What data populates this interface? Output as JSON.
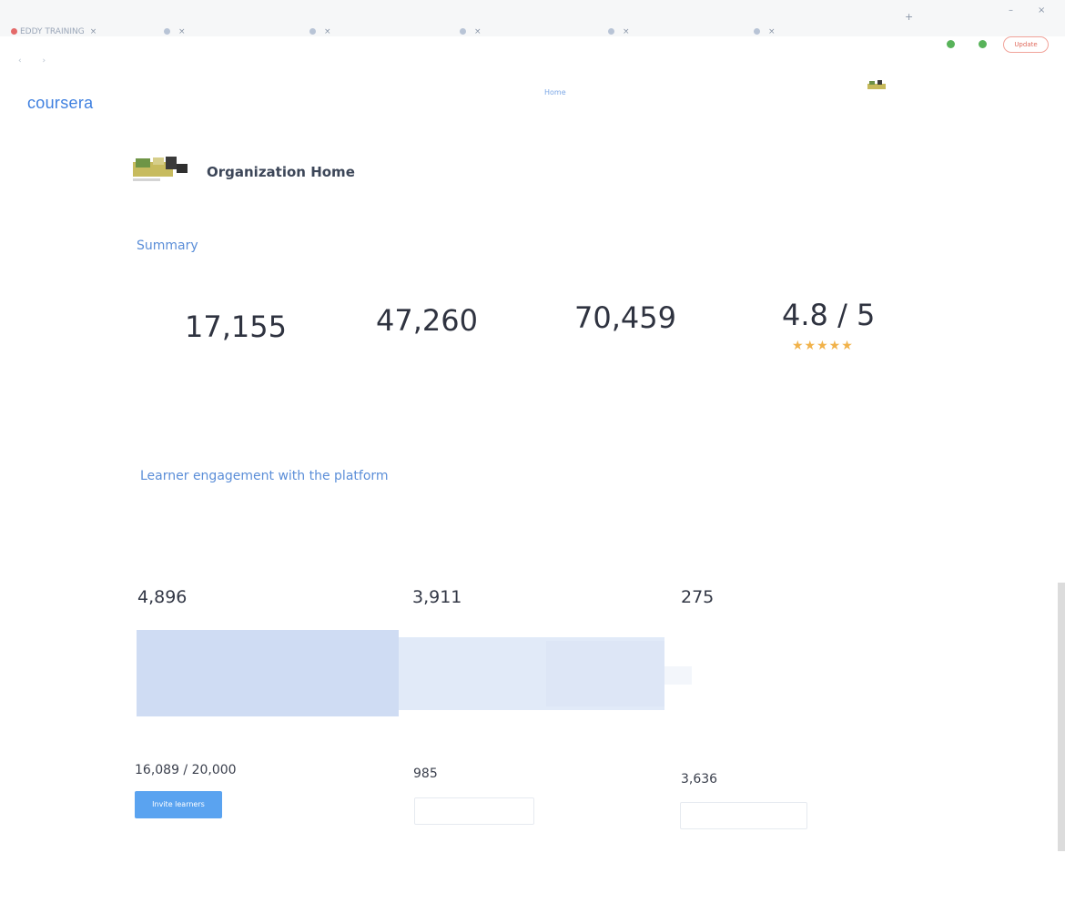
{
  "browser": {
    "tabs": [
      {
        "label": "EDDY TRAINING",
        "favicon": "red"
      },
      {
        "label": "",
        "favicon": "blue"
      },
      {
        "label": "",
        "favicon": "blue"
      },
      {
        "label": "",
        "favicon": "blue"
      },
      {
        "label": "",
        "favicon": "blue"
      },
      {
        "label": "",
        "favicon": "blue"
      }
    ],
    "profile_button": "Update"
  },
  "header": {
    "logo": "coursera",
    "nav_home": "Home"
  },
  "org": {
    "title": "Organization Home"
  },
  "summary": {
    "title": "Summary",
    "metrics": [
      {
        "value": "17,155"
      },
      {
        "value": "47,260"
      },
      {
        "value": "70,459"
      },
      {
        "value": "4.8 / 5"
      }
    ],
    "rating_stars": 5
  },
  "engagement": {
    "title": "Learner engagement with the platform",
    "columns": [
      {
        "value": "4,896"
      },
      {
        "value": "3,911"
      },
      {
        "value": "275"
      }
    ],
    "bottom": [
      {
        "value": "16,089 / 20,000",
        "button": "Invite learners"
      },
      {
        "value": "985"
      },
      {
        "value": "3,636"
      }
    ]
  },
  "colors": {
    "brand": "#3f80e0",
    "section_title": "#5b8ed8",
    "star": "#f1b24a",
    "primary_button": "#5aa3f0",
    "funnel_1": "#cfdcf3",
    "funnel_2": "#e1eaf8",
    "funnel_3": "#eaf1fa"
  }
}
